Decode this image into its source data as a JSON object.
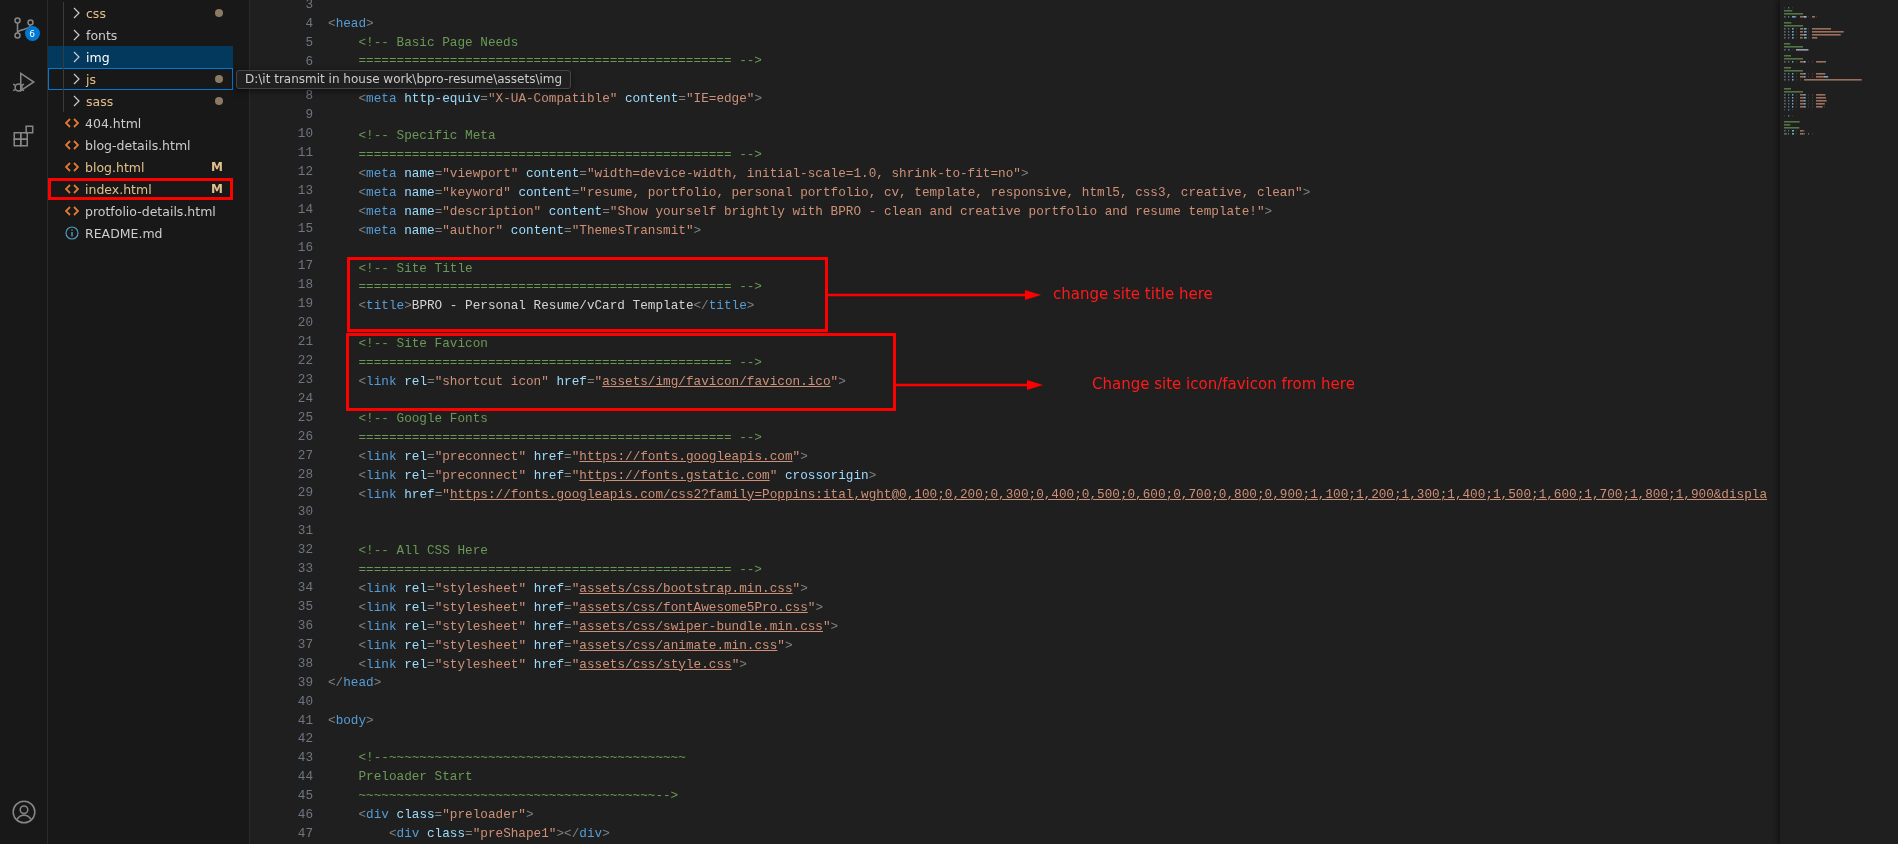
{
  "activity_bar": {
    "items": [
      {
        "kind": "source-control",
        "badge": "6"
      },
      {
        "kind": "debug"
      },
      {
        "kind": "extensions"
      }
    ],
    "account": {
      "kind": "account"
    }
  },
  "explorer": {
    "items": [
      {
        "kind": "folder",
        "name": "css",
        "modified": true,
        "selected": false,
        "focused": false,
        "annotated": false
      },
      {
        "kind": "folder",
        "name": "fonts",
        "modified": false,
        "selected": false,
        "focused": false,
        "annotated": false
      },
      {
        "kind": "folder",
        "name": "img",
        "modified": false,
        "selected": true,
        "focused": false,
        "annotated": false
      },
      {
        "kind": "folder",
        "name": "js",
        "modified": true,
        "selected": false,
        "focused": true,
        "annotated": false
      },
      {
        "kind": "folder",
        "name": "sass",
        "modified": true,
        "selected": false,
        "focused": false,
        "annotated": false
      },
      {
        "kind": "html",
        "name": "404.html",
        "modified": false,
        "selected": false,
        "focused": false,
        "annotated": false
      },
      {
        "kind": "html",
        "name": "blog-details.html",
        "modified": false,
        "selected": false,
        "focused": false,
        "annotated": false
      },
      {
        "kind": "html",
        "name": "blog.html",
        "modified": true,
        "badge": "M",
        "selected": false,
        "focused": false,
        "annotated": false
      },
      {
        "kind": "html",
        "name": "index.html",
        "modified": true,
        "badge": "M",
        "selected": false,
        "focused": false,
        "annotated": true
      },
      {
        "kind": "html",
        "name": "protfolio-details.html",
        "modified": false,
        "selected": false,
        "focused": false,
        "annotated": false
      },
      {
        "kind": "info",
        "name": "README.md",
        "modified": false,
        "selected": false,
        "focused": false,
        "annotated": false
      }
    ],
    "tooltip": {
      "text": "D:\\it transmit in house work\\bpro-resume\\assets\\img"
    }
  },
  "editor": {
    "lines": [
      {
        "number": "3"
      },
      {
        "number": "4",
        "tokens": [
          {
            "kind": "punct",
            "text": "<"
          },
          {
            "kind": "tag",
            "text": "head"
          },
          {
            "kind": "punct",
            "text": ">"
          }
        ]
      },
      {
        "number": "5",
        "tokens": [
          {
            "kind": "comment",
            "text": "    <!-- Basic Page Needs"
          }
        ]
      },
      {
        "number": "6",
        "tokens": [
          {
            "kind": "comment",
            "text": "    ================================================= -->"
          }
        ]
      },
      {
        "number": "8",
        "tokens": [
          {
            "kind": "punct",
            "text": "    <"
          },
          {
            "kind": "tag",
            "text": "meta"
          },
          {
            "kind": "attr",
            "text": " http-equiv"
          },
          {
            "kind": "punct",
            "text": "="
          },
          {
            "kind": "string",
            "text": "\"X-UA-Compatible\""
          },
          {
            "kind": "attr",
            "text": " content"
          },
          {
            "kind": "punct",
            "text": "="
          },
          {
            "kind": "string",
            "text": "\"IE=edge\""
          },
          {
            "kind": "punct",
            "text": ">"
          }
        ]
      },
      {
        "number": "9"
      },
      {
        "number": "10",
        "tokens": [
          {
            "kind": "comment",
            "text": "    <!-- Specific Meta"
          }
        ]
      },
      {
        "number": "11",
        "tokens": [
          {
            "kind": "comment",
            "text": "    ================================================= -->"
          }
        ]
      },
      {
        "number": "12",
        "tokens": [
          {
            "kind": "punct",
            "text": "    <"
          },
          {
            "kind": "tag",
            "text": "meta"
          },
          {
            "kind": "attr",
            "text": " name"
          },
          {
            "kind": "punct",
            "text": "="
          },
          {
            "kind": "string",
            "text": "\"viewport\""
          },
          {
            "kind": "attr",
            "text": " content"
          },
          {
            "kind": "punct",
            "text": "="
          },
          {
            "kind": "string",
            "text": "\"width=device-width, initial-scale=1.0, shrink-to-fit=no\""
          },
          {
            "kind": "punct",
            "text": ">"
          }
        ]
      },
      {
        "number": "13",
        "tokens": [
          {
            "kind": "punct",
            "text": "    <"
          },
          {
            "kind": "tag",
            "text": "meta"
          },
          {
            "kind": "attr",
            "text": " name"
          },
          {
            "kind": "punct",
            "text": "="
          },
          {
            "kind": "string",
            "text": "\"keyword\""
          },
          {
            "kind": "attr",
            "text": " content"
          },
          {
            "kind": "punct",
            "text": "="
          },
          {
            "kind": "string",
            "text": "\"resume, portfolio, personal portfolio, cv, template, responsive, html5, css3, creative, clean\""
          },
          {
            "kind": "punct",
            "text": ">"
          }
        ]
      },
      {
        "number": "14",
        "tokens": [
          {
            "kind": "punct",
            "text": "    <"
          },
          {
            "kind": "tag",
            "text": "meta"
          },
          {
            "kind": "attr",
            "text": " name"
          },
          {
            "kind": "punct",
            "text": "="
          },
          {
            "kind": "string",
            "text": "\"description\""
          },
          {
            "kind": "attr",
            "text": " content"
          },
          {
            "kind": "punct",
            "text": "="
          },
          {
            "kind": "string",
            "text": "\"Show yourself brightly with BPRO - clean and creative portfolio and resume template!\""
          },
          {
            "kind": "punct",
            "text": ">"
          }
        ]
      },
      {
        "number": "15",
        "tokens": [
          {
            "kind": "punct",
            "text": "    <"
          },
          {
            "kind": "tag",
            "text": "meta"
          },
          {
            "kind": "attr",
            "text": " name"
          },
          {
            "kind": "punct",
            "text": "="
          },
          {
            "kind": "string",
            "text": "\"author\""
          },
          {
            "kind": "attr",
            "text": " content"
          },
          {
            "kind": "punct",
            "text": "="
          },
          {
            "kind": "string",
            "text": "\"ThemesTransmit\""
          },
          {
            "kind": "punct",
            "text": ">"
          }
        ]
      },
      {
        "number": "16"
      },
      {
        "number": "17",
        "tokens": [
          {
            "kind": "comment",
            "text": "    <!-- Site Title"
          }
        ]
      },
      {
        "number": "18",
        "tokens": [
          {
            "kind": "comment",
            "text": "    ================================================= -->"
          }
        ]
      },
      {
        "number": "19",
        "tokens": [
          {
            "kind": "punct",
            "text": "    <"
          },
          {
            "kind": "tag",
            "text": "title"
          },
          {
            "kind": "punct",
            "text": ">"
          },
          {
            "kind": "plain",
            "text": "BPRO - Personal Resume/vCard Template"
          },
          {
            "kind": "punct",
            "text": "</"
          },
          {
            "kind": "tag",
            "text": "title"
          },
          {
            "kind": "punct",
            "text": ">"
          }
        ]
      },
      {
        "number": "20"
      },
      {
        "number": "21",
        "tokens": [
          {
            "kind": "comment",
            "text": "    <!-- Site Favicon"
          }
        ]
      },
      {
        "number": "22",
        "tokens": [
          {
            "kind": "comment",
            "text": "    ================================================= -->"
          }
        ]
      },
      {
        "number": "23",
        "tokens": [
          {
            "kind": "punct",
            "text": "    <"
          },
          {
            "kind": "tag",
            "text": "link"
          },
          {
            "kind": "attr",
            "text": " rel"
          },
          {
            "kind": "punct",
            "text": "="
          },
          {
            "kind": "string",
            "text": "\"shortcut icon\""
          },
          {
            "kind": "attr",
            "text": " href"
          },
          {
            "kind": "punct",
            "text": "="
          },
          {
            "kind": "string",
            "text": "\""
          },
          {
            "kind": "link",
            "text": "assets/img/favicon/favicon.ico"
          },
          {
            "kind": "string",
            "text": "\""
          },
          {
            "kind": "punct",
            "text": ">"
          }
        ]
      },
      {
        "number": "24"
      },
      {
        "number": "25",
        "tokens": [
          {
            "kind": "comment",
            "text": "    <!-- Google Fonts"
          }
        ]
      },
      {
        "number": "26",
        "tokens": [
          {
            "kind": "comment",
            "text": "    ================================================= -->"
          }
        ]
      },
      {
        "number": "27",
        "tokens": [
          {
            "kind": "punct",
            "text": "    <"
          },
          {
            "kind": "tag",
            "text": "link"
          },
          {
            "kind": "attr",
            "text": " rel"
          },
          {
            "kind": "punct",
            "text": "="
          },
          {
            "kind": "string",
            "text": "\"preconnect\""
          },
          {
            "kind": "attr",
            "text": " href"
          },
          {
            "kind": "punct",
            "text": "="
          },
          {
            "kind": "string",
            "text": "\""
          },
          {
            "kind": "link",
            "text": "https://fonts.googleapis.com"
          },
          {
            "kind": "string",
            "text": "\""
          },
          {
            "kind": "punct",
            "text": ">"
          }
        ]
      },
      {
        "number": "28",
        "tokens": [
          {
            "kind": "punct",
            "text": "    <"
          },
          {
            "kind": "tag",
            "text": "link"
          },
          {
            "kind": "attr",
            "text": " rel"
          },
          {
            "kind": "punct",
            "text": "="
          },
          {
            "kind": "string",
            "text": "\"preconnect\""
          },
          {
            "kind": "attr",
            "text": " href"
          },
          {
            "kind": "punct",
            "text": "="
          },
          {
            "kind": "string",
            "text": "\""
          },
          {
            "kind": "link",
            "text": "https://fonts.gstatic.com"
          },
          {
            "kind": "string",
            "text": "\""
          },
          {
            "kind": "attr",
            "text": " crossorigin"
          },
          {
            "kind": "punct",
            "text": ">"
          }
        ]
      },
      {
        "number": "29",
        "tokens": [
          {
            "kind": "punct",
            "text": "    <"
          },
          {
            "kind": "tag",
            "text": "link"
          },
          {
            "kind": "attr",
            "text": " href"
          },
          {
            "kind": "punct",
            "text": "="
          },
          {
            "kind": "string",
            "text": "\""
          },
          {
            "kind": "link",
            "text": "https://fonts.googleapis.com/css2?family=Poppins:ital,wght@0,100;0,200;0,300;0,400;0,500;0,600;0,700;0,800;0,900;1,100;1,200;1,300;1,400;1,500;1,600;1,700;1,800;1,900&displa"
          }
        ]
      },
      {
        "number": "30"
      },
      {
        "number": "31"
      },
      {
        "number": "32",
        "tokens": [
          {
            "kind": "comment",
            "text": "    <!-- All CSS Here"
          }
        ]
      },
      {
        "number": "33",
        "tokens": [
          {
            "kind": "comment",
            "text": "    ================================================= -->"
          }
        ]
      },
      {
        "number": "34",
        "tokens": [
          {
            "kind": "punct",
            "text": "    <"
          },
          {
            "kind": "tag",
            "text": "link"
          },
          {
            "kind": "attr",
            "text": " rel"
          },
          {
            "kind": "punct",
            "text": "="
          },
          {
            "kind": "string",
            "text": "\"stylesheet\""
          },
          {
            "kind": "attr",
            "text": " href"
          },
          {
            "kind": "punct",
            "text": "="
          },
          {
            "kind": "string",
            "text": "\""
          },
          {
            "kind": "link",
            "text": "assets/css/bootstrap.min.css"
          },
          {
            "kind": "string",
            "text": "\""
          },
          {
            "kind": "punct",
            "text": ">"
          }
        ]
      },
      {
        "number": "35",
        "tokens": [
          {
            "kind": "punct",
            "text": "    <"
          },
          {
            "kind": "tag",
            "text": "link"
          },
          {
            "kind": "attr",
            "text": " rel"
          },
          {
            "kind": "punct",
            "text": "="
          },
          {
            "kind": "string",
            "text": "\"stylesheet\""
          },
          {
            "kind": "attr",
            "text": " href"
          },
          {
            "kind": "punct",
            "text": "="
          },
          {
            "kind": "string",
            "text": "\""
          },
          {
            "kind": "link",
            "text": "assets/css/fontAwesome5Pro.css"
          },
          {
            "kind": "string",
            "text": "\""
          },
          {
            "kind": "punct",
            "text": ">"
          }
        ]
      },
      {
        "number": "36",
        "tokens": [
          {
            "kind": "punct",
            "text": "    <"
          },
          {
            "kind": "tag",
            "text": "link"
          },
          {
            "kind": "attr",
            "text": " rel"
          },
          {
            "kind": "punct",
            "text": "="
          },
          {
            "kind": "string",
            "text": "\"stylesheet\""
          },
          {
            "kind": "attr",
            "text": " href"
          },
          {
            "kind": "punct",
            "text": "="
          },
          {
            "kind": "string",
            "text": "\""
          },
          {
            "kind": "link",
            "text": "assets/css/swiper-bundle.min.css"
          },
          {
            "kind": "string",
            "text": "\""
          },
          {
            "kind": "punct",
            "text": ">"
          }
        ]
      },
      {
        "number": "37",
        "tokens": [
          {
            "kind": "punct",
            "text": "    <"
          },
          {
            "kind": "tag",
            "text": "link"
          },
          {
            "kind": "attr",
            "text": " rel"
          },
          {
            "kind": "punct",
            "text": "="
          },
          {
            "kind": "string",
            "text": "\"stylesheet\""
          },
          {
            "kind": "attr",
            "text": " href"
          },
          {
            "kind": "punct",
            "text": "="
          },
          {
            "kind": "string",
            "text": "\""
          },
          {
            "kind": "link",
            "text": "assets/css/animate.min.css"
          },
          {
            "kind": "string",
            "text": "\""
          },
          {
            "kind": "punct",
            "text": ">"
          }
        ]
      },
      {
        "number": "38",
        "tokens": [
          {
            "kind": "punct",
            "text": "    <"
          },
          {
            "kind": "tag",
            "text": "link"
          },
          {
            "kind": "attr",
            "text": " rel"
          },
          {
            "kind": "punct",
            "text": "="
          },
          {
            "kind": "string",
            "text": "\"stylesheet\""
          },
          {
            "kind": "attr",
            "text": " href"
          },
          {
            "kind": "punct",
            "text": "="
          },
          {
            "kind": "string",
            "text": "\""
          },
          {
            "kind": "link",
            "text": "assets/css/style.css"
          },
          {
            "kind": "string",
            "text": "\""
          },
          {
            "kind": "punct",
            "text": ">"
          }
        ]
      },
      {
        "number": "39",
        "tokens": [
          {
            "kind": "punct",
            "text": "</"
          },
          {
            "kind": "tag",
            "text": "head"
          },
          {
            "kind": "punct",
            "text": ">"
          }
        ]
      },
      {
        "number": "40"
      },
      {
        "number": "41",
        "tokens": [
          {
            "kind": "punct",
            "text": "<"
          },
          {
            "kind": "tag",
            "text": "body"
          },
          {
            "kind": "punct",
            "text": ">"
          }
        ]
      },
      {
        "number": "42"
      },
      {
        "number": "43",
        "tokens": [
          {
            "kind": "comment",
            "text": "    <!--~~~~~~~~~~~~~~~~~~~~~~~~~~~~~~~~~~~~~~~"
          }
        ]
      },
      {
        "number": "44",
        "tokens": [
          {
            "kind": "comment",
            "text": "    Preloader Start"
          }
        ]
      },
      {
        "number": "45",
        "tokens": [
          {
            "kind": "comment",
            "text": "    ~~~~~~~~~~~~~~~~~~~~~~~~~~~~~~~~~~~~~~~-->"
          }
        ]
      },
      {
        "number": "46",
        "tokens": [
          {
            "kind": "punct",
            "text": "    <"
          },
          {
            "kind": "tag",
            "text": "div"
          },
          {
            "kind": "attr",
            "text": " class"
          },
          {
            "kind": "punct",
            "text": "="
          },
          {
            "kind": "string",
            "text": "\"preloader\""
          },
          {
            "kind": "punct",
            "text": ">"
          }
        ]
      },
      {
        "number": "47",
        "tokens": [
          {
            "kind": "punct",
            "text": "        <"
          },
          {
            "kind": "tag",
            "text": "div"
          },
          {
            "kind": "attr",
            "text": " class"
          },
          {
            "kind": "punct",
            "text": "="
          },
          {
            "kind": "string",
            "text": "\"preShape1\""
          },
          {
            "kind": "punct",
            "text": "></"
          },
          {
            "kind": "tag",
            "text": "div"
          },
          {
            "kind": "punct",
            "text": ">"
          }
        ]
      }
    ],
    "annotations": [
      {
        "text": "change site title here"
      },
      {
        "text": "Change site icon/favicon from here"
      }
    ]
  }
}
